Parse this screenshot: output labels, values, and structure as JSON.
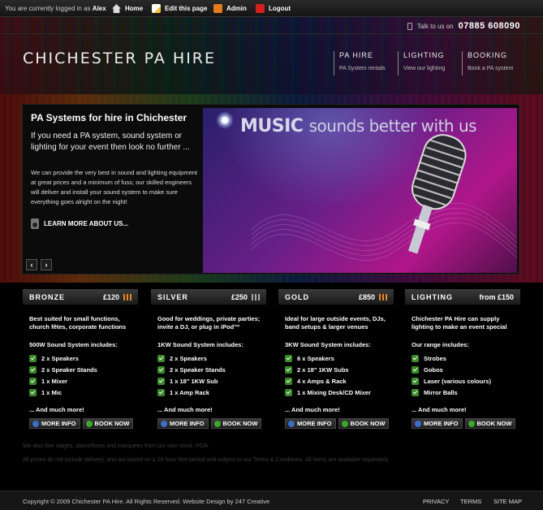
{
  "admin_bar": {
    "logged_prefix": "You are currently logged in as",
    "user": "Alex",
    "links": [
      "Home",
      "Edit this page",
      "Admin",
      "Logout"
    ]
  },
  "header": {
    "talk_prefix": "Talk to us on",
    "phone": "07885 608090",
    "logo": "CHICHESTER PA HIRE",
    "nav": [
      {
        "title": "PA HIRE",
        "sub": "PA System rentals"
      },
      {
        "title": "LIGHTING",
        "sub": "View our lighting"
      },
      {
        "title": "BOOKING",
        "sub": "Book a PA system"
      }
    ]
  },
  "hero": {
    "title": "PA Systems for hire in Chichester",
    "lead": "If you need a PA system, sound system or lighting for your event then look no further ...",
    "body": "We can provide the very best in sound and lighting equipment at great prices and a minimum of fuss; our skilled engineers will deliver and install your sound system to make sure everything goes alright on the night!",
    "learn_more": "LEARN MORE ABOUT US...",
    "prev": "‹",
    "next": "›",
    "banner_bold": "MUSIC",
    "banner_rest": "sounds better with us"
  },
  "packages": [
    {
      "name": "BRONZE",
      "price": "£120",
      "desc": "Best suited for small functions, church fêtes, corporate functions",
      "includes": "500W Sound System includes:",
      "items": [
        "2 x Speakers",
        "2 x Speaker Stands",
        "1 x Mixer",
        "1 x Mic"
      ],
      "more": "... And much more!"
    },
    {
      "name": "SILVER",
      "price": "£250",
      "desc": "Good for weddings, private parties; invite a DJ, or plug in iPod™",
      "includes": "1KW Sound System includes:",
      "items": [
        "2 x Speakers",
        "2 x Speaker Stands",
        "1 x 18\" 1KW Sub",
        "1 x Amp Rack"
      ],
      "more": "... And much more!"
    },
    {
      "name": "GOLD",
      "price": "£850",
      "desc": "Ideal for large outside events, DJs, band setups & larger venues",
      "includes": "3KW Sound System includes:",
      "items": [
        "6 x Speakers",
        "2 x 18\" 1KW Subs",
        "4 x Amps & Rack",
        "1 x Mixing Desk/CD Mixer"
      ],
      "more": "... And much more!"
    },
    {
      "name": "LIGHTING",
      "price": "from £150",
      "desc": "Chichester PA Hire can supply lighting to make an event special",
      "includes": "Our range includes:",
      "items": [
        "Strobes",
        "Gobos",
        "Laser (various colours)",
        "Mirror Balls"
      ],
      "more": "... And much more!"
    }
  ],
  "buttons": {
    "more_info": "MORE INFO",
    "book_now": "BOOK NOW"
  },
  "notes": [
    "We also hire stages, dancefloors and marquees from our own stock. POA.",
    "All prices do not include delivery, and are based on a 24 hour hire period and subject to our Terms & Conditions. All items are available separately."
  ],
  "footer": {
    "copyright": "Copyright © 2009 Chichester PA Hire. All Rights Reserved. Website Design by 247 Creative",
    "links": [
      "PRIVACY",
      "TERMS",
      "SITE MAP"
    ]
  }
}
